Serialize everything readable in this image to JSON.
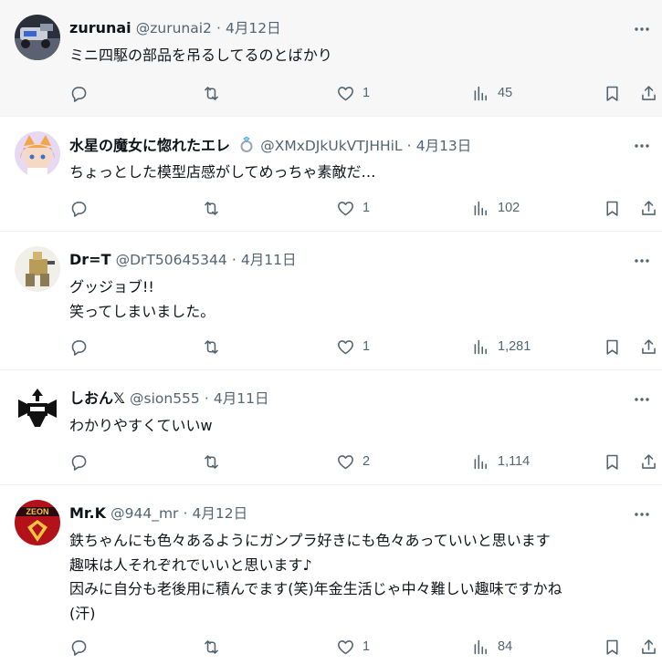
{
  "tweets": [
    {
      "name": "zurunai",
      "handle": "@zurunai2",
      "dot": "·",
      "date": "4月12日",
      "text": "ミニ四駆の部品を吊るしてるのとばかり",
      "likes": "1",
      "views": "45",
      "replies": "",
      "retweets": ""
    },
    {
      "name": "水星の魔女に惚れたエレ",
      "handle": "@XMxDJkUkVTJHHiL",
      "dot": "·",
      "date": "4月13日",
      "text": "ちょっとした模型店感がしてめっちゃ素敵だ…",
      "likes": "1",
      "views": "102",
      "replies": "",
      "retweets": ""
    },
    {
      "name": "Dr=T",
      "handle": "@DrT50645344",
      "dot": "·",
      "date": "4月11日",
      "text": "グッジョブ!!\n笑ってしまいました。",
      "likes": "1",
      "views": "1,281",
      "replies": "",
      "retweets": ""
    },
    {
      "name": "しおん𝕏",
      "handle": "@sion555",
      "dot": "·",
      "date": "4月11日",
      "text": "わかりやすくていいw",
      "likes": "2",
      "views": "1,114",
      "replies": "",
      "retweets": ""
    },
    {
      "name": "Mr.K",
      "handle": "@944_mr",
      "dot": "·",
      "date": "4月12日",
      "text": "鉄ちゃんにも色々あるようにガンプラ好きにも色々あっていいと思います\n趣味は人それぞれでいいと思います♪\n因みに自分も老後用に積んでます(笑)年金生活じゃ中々難しい趣味ですかね\n(汗)",
      "likes": "1",
      "views": "84",
      "replies": "",
      "retweets": ""
    }
  ],
  "avatar5_label": "ZEON",
  "colors": {
    "text": "#0f1419",
    "secondary": "#536471",
    "border": "#eff3f4",
    "hover": "#f7f7f7"
  }
}
